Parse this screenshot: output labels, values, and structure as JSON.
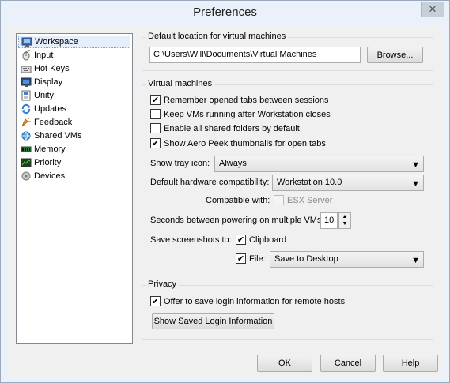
{
  "window": {
    "title": "Preferences",
    "close_glyph": "✕"
  },
  "sidebar": {
    "items": [
      {
        "label": "Workspace",
        "icon": "workspace-icon"
      },
      {
        "label": "Input",
        "icon": "input-icon"
      },
      {
        "label": "Hot Keys",
        "icon": "hotkeys-icon"
      },
      {
        "label": "Display",
        "icon": "display-icon"
      },
      {
        "label": "Unity",
        "icon": "unity-icon"
      },
      {
        "label": "Updates",
        "icon": "updates-icon"
      },
      {
        "label": "Feedback",
        "icon": "feedback-icon"
      },
      {
        "label": "Shared VMs",
        "icon": "shared-vms-icon"
      },
      {
        "label": "Memory",
        "icon": "memory-icon"
      },
      {
        "label": "Priority",
        "icon": "priority-icon"
      },
      {
        "label": "Devices",
        "icon": "devices-icon"
      }
    ],
    "selected": "Workspace"
  },
  "default_location": {
    "group_label": "Default location for virtual machines",
    "path": "C:\\Users\\Will\\Documents\\Virtual Machines",
    "browse_label": "Browse..."
  },
  "virtual_machines": {
    "group_label": "Virtual machines",
    "checkboxes": [
      {
        "label": "Remember opened tabs between sessions",
        "checked": true
      },
      {
        "label": "Keep VMs running after Workstation closes",
        "checked": false
      },
      {
        "label": "Enable all shared folders by default",
        "checked": false
      },
      {
        "label": "Show Aero Peek thumbnails for open tabs",
        "checked": true
      }
    ],
    "tray_icon_label": "Show tray icon:",
    "tray_icon_value": "Always",
    "hw_compat_label": "Default hardware compatibility:",
    "hw_compat_value": "Workstation 10.0",
    "compatible_with_label": "Compatible with:",
    "esx_server_label": "ESX Server",
    "esx_server_checked": false,
    "seconds_label": "Seconds between powering on multiple VMs:",
    "seconds_value": "10",
    "save_screenshots_label": "Save screenshots to:",
    "clipboard_label": "Clipboard",
    "clipboard_checked": true,
    "file_label": "File:",
    "file_checked": true,
    "file_value": "Save to Desktop"
  },
  "privacy": {
    "group_label": "Privacy",
    "offer_label": "Offer to save login information for remote hosts",
    "offer_checked": true,
    "show_saved_label": "Show Saved Login Information"
  },
  "footer": {
    "ok_label": "OK",
    "cancel_label": "Cancel",
    "help_label": "Help"
  },
  "glyphs": {
    "check": "✔",
    "dropdown": "▼",
    "spin_up": "▲",
    "spin_down": "▼"
  },
  "colors": {
    "accent": "#e5eef9",
    "window_bg": "#eaf1fa",
    "client_bg": "#f0f0f0"
  }
}
